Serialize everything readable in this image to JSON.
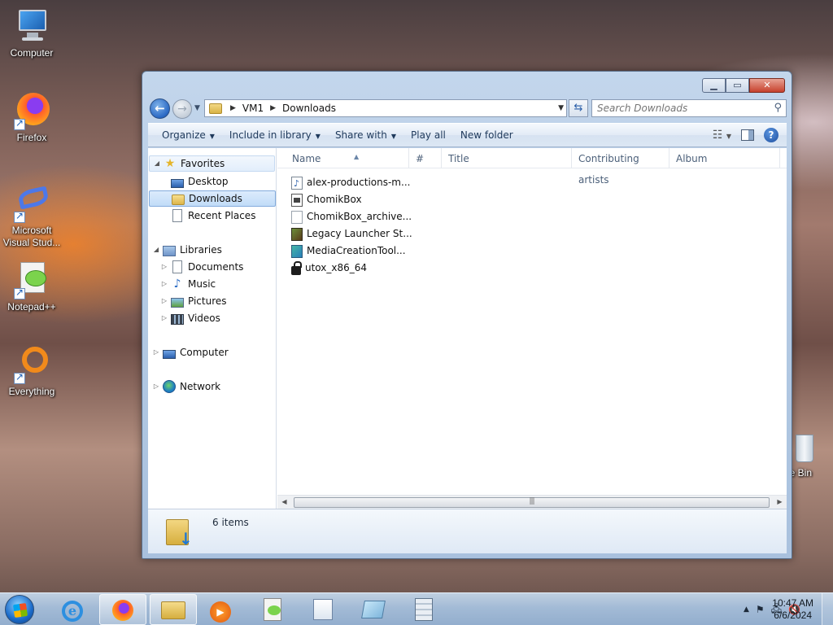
{
  "desktop": {
    "icons": [
      {
        "label": "Computer",
        "icon": "computer-icon"
      },
      {
        "label": "Firefox",
        "icon": "firefox-icon"
      },
      {
        "label": "Microsoft Visual Stud...",
        "icon": "visual-studio-icon"
      },
      {
        "label": "Notepad++",
        "icon": "notepadpp-icon"
      },
      {
        "label": "Everything",
        "icon": "everything-icon"
      }
    ],
    "recycle_bin_label": "le Bin"
  },
  "window": {
    "caption_buttons": {
      "minimize": "▁",
      "maximize": "▭",
      "close": "✕"
    },
    "breadcrumb": [
      "VM1",
      "Downloads"
    ],
    "search_placeholder": "Search Downloads",
    "toolbar": {
      "organize": "Organize",
      "include_in_library": "Include in library",
      "share_with": "Share with",
      "play_all": "Play all",
      "new_folder": "New folder"
    },
    "nav": {
      "favorites": "Favorites",
      "desktop": "Desktop",
      "downloads": "Downloads",
      "recent_places": "Recent Places",
      "libraries": "Libraries",
      "documents": "Documents",
      "music": "Music",
      "pictures": "Pictures",
      "videos": "Videos",
      "computer": "Computer",
      "network": "Network"
    },
    "columns": [
      "Name",
      "#",
      "Title",
      "Contributing artists",
      "Album"
    ],
    "files": [
      {
        "name": "alex-productions-m...",
        "icon": "audio-file-icon"
      },
      {
        "name": "ChomikBox",
        "icon": "application-icon"
      },
      {
        "name": "ChomikBox_archive...",
        "icon": "blank-file-icon"
      },
      {
        "name": "Legacy Launcher St...",
        "icon": "minecraft-launcher-icon"
      },
      {
        "name": "MediaCreationTool...",
        "icon": "media-creation-tool-icon"
      },
      {
        "name": "utox_x86_64",
        "icon": "lock-app-icon"
      }
    ],
    "item_count": "6 items"
  },
  "taskbar": {
    "apps": [
      "internet-explorer-icon",
      "firefox-icon",
      "file-explorer-icon",
      "media-player-icon",
      "notepadpp-icon",
      "wordpad-icon",
      "paint-icon",
      "calculator-icon"
    ],
    "clock_time": "10:47 AM",
    "clock_date": "6/6/2024"
  }
}
